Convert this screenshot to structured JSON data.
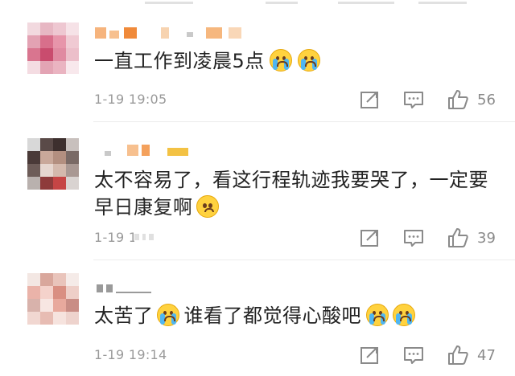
{
  "comments": [
    {
      "text": "一直工作到凌晨5点",
      "time": "1-19 19:05",
      "likes": "56",
      "emoji_after": [
        "crying-face",
        "crying-face"
      ],
      "accent": "#ffd23f"
    },
    {
      "text_line1": "太不容易了，看这行程轨迹我要哭了，一定要",
      "text_line2": "早日康复啊",
      "time": "1-19 19:",
      "likes": "39",
      "emoji_after": [
        "pleading-face"
      ]
    },
    {
      "text_part1": "太苦了",
      "text_part2": "谁看了都觉得心酸吧",
      "time": "1-19 19:14",
      "likes": "47",
      "emoji_after": [
        "crying-face",
        "crying-face",
        "crying-face"
      ]
    }
  ],
  "icons": {
    "share": "share-icon",
    "comment": "comment-icon",
    "like": "thumbs-up-icon"
  },
  "colors": {
    "text": "#222222",
    "meta": "#9a9a9a",
    "divider": "#ececec"
  }
}
